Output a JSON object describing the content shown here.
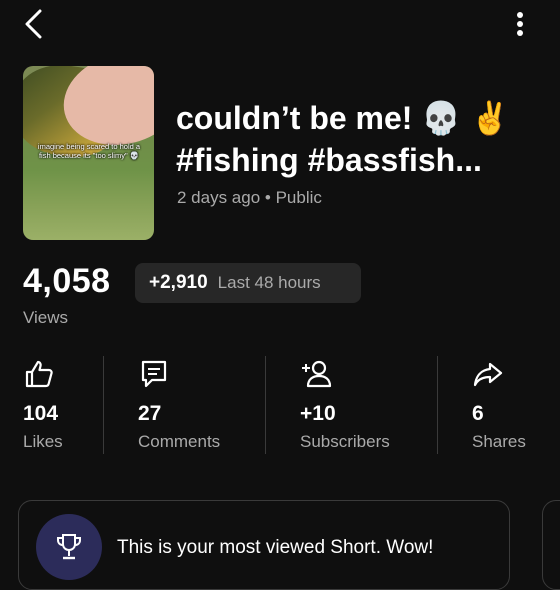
{
  "header": {
    "back_icon": "chevron-left-icon",
    "menu_icon": "more-vert-icon"
  },
  "video": {
    "thumbnail_caption": "imagine being scared to hold a fish because its \"too slimy\" 💀",
    "title": "couldn’t be me! 💀 ✌️\n#fishing #bassfish...",
    "meta": "2 days ago • Public"
  },
  "views": {
    "count": "4,058",
    "delta": "+2,910",
    "period": "Last 48 hours",
    "label": "Views"
  },
  "stats": [
    {
      "icon": "thumb-up-icon",
      "value": "104",
      "label": "Likes"
    },
    {
      "icon": "comment-icon",
      "value": "27",
      "label": "Comments"
    },
    {
      "icon": "add-person-icon",
      "value": "+10",
      "label": "Subscribers"
    },
    {
      "icon": "share-icon",
      "value": "6",
      "label": "Shares"
    }
  ],
  "card": {
    "icon": "trophy-icon",
    "text": "This is your most viewed Short. Wow!"
  },
  "colors": {
    "background": "#0f0f0f",
    "secondary_text": "#aaaaaa",
    "chip": "#272727",
    "trophy_bg": "#2c2c5a"
  }
}
